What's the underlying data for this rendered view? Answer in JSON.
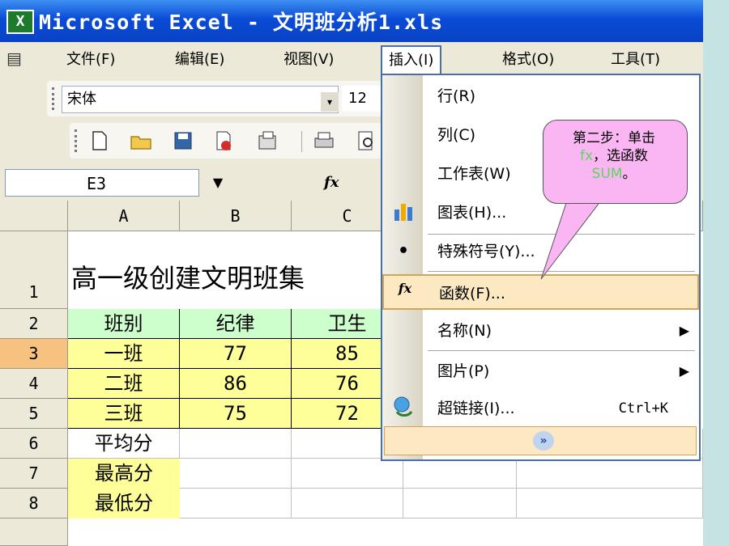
{
  "window": {
    "app_icon": "X",
    "title": "Microsoft Excel - 文明班分析1.xls"
  },
  "menubar": {
    "items": [
      "文件(F)",
      "编辑(E)",
      "视图(V)",
      "插入(I)",
      "格式(O)",
      "工具(T)"
    ],
    "active": "插入(I)"
  },
  "format_toolbar": {
    "font": "宋体",
    "size": "12"
  },
  "formula_bar": {
    "cell_ref": "E3",
    "fx_icon": "fx"
  },
  "sheet": {
    "columns": [
      "A",
      "B",
      "C"
    ],
    "rows": [
      "1",
      "2",
      "3",
      "4",
      "5",
      "6",
      "7",
      "8"
    ],
    "selected_row": "3",
    "title": "高一级创建文明班集",
    "header_row": [
      "班别",
      "纪律",
      "卫生"
    ],
    "data_rows": [
      [
        "一班",
        "77",
        "85"
      ],
      [
        "二班",
        "86",
        "76"
      ],
      [
        "三班",
        "75",
        "72"
      ]
    ],
    "stat_labels": [
      "平均分",
      "最高分",
      "最低分"
    ]
  },
  "insert_menu": {
    "items": [
      {
        "label": "行(R)",
        "icon": ""
      },
      {
        "label": "列(C)",
        "icon": ""
      },
      {
        "label": "工作表(W)",
        "icon": ""
      },
      {
        "label": "图表(H)...",
        "icon": "chart-icon"
      },
      {
        "label": "特殊符号(Y)...",
        "icon": "bullet-icon"
      },
      {
        "label": "函数(F)...",
        "icon": "fx-icon"
      },
      {
        "label": "名称(N)",
        "icon": "",
        "submenu": true
      },
      {
        "label": "图片(P)",
        "icon": "",
        "submenu": true
      },
      {
        "label": "超链接(I)...",
        "icon": "hyperlink-icon",
        "shortcut": "Ctrl+K"
      }
    ],
    "highlighted": "函数(F)...",
    "expand_icon": "double-chevron-down-icon"
  },
  "callout": {
    "line1": "第二步：单击",
    "line2_green": "fx",
    "line2_rest": "，选函数",
    "line3_green": "SUM",
    "line3_rest": "。"
  },
  "colors": {
    "header_fill": "#ccffcc",
    "data_fill": "#ffff99",
    "menu_highlight": "#fce9c2",
    "callout_fill": "#f9b6f2",
    "title_bar": "#0a4bd6",
    "selected_row_header": "#f7c27f"
  }
}
